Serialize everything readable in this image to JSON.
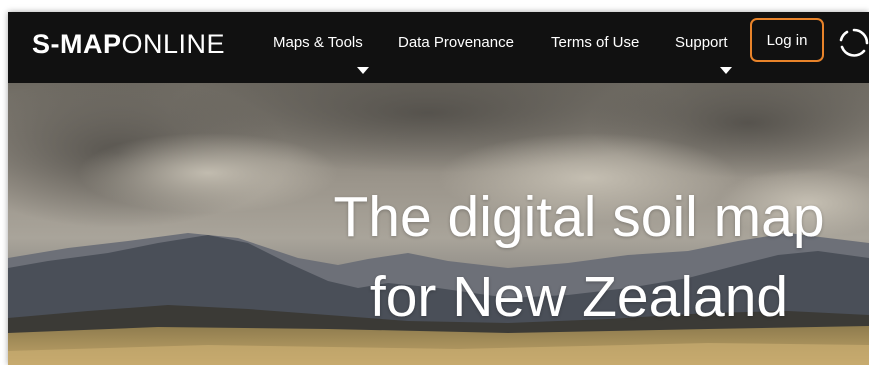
{
  "brand": {
    "bold": "S-MAP",
    "light": "ONLINE"
  },
  "nav": {
    "maps_tools": "Maps & Tools",
    "data_provenance": "Data Provenance",
    "terms_of_use": "Terms of Use",
    "support": "Support",
    "login": "Log in"
  },
  "hero": {
    "headline_line1": "The digital soil map",
    "headline_line2": "for New Zealand"
  },
  "colors": {
    "navbar_bg": "#111111",
    "login_border": "#e8832a",
    "text": "#ffffff"
  },
  "icons": [
    "chevron-down-icon",
    "refresh-spinner-icon"
  ]
}
